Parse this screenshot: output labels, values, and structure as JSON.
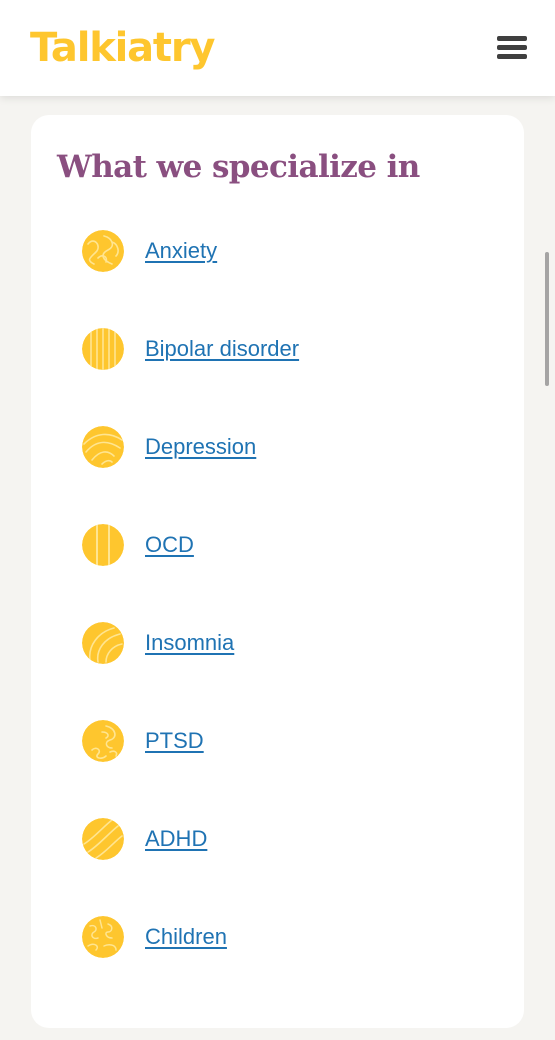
{
  "header": {
    "logo_text": "Talkiatry",
    "menu_icon": "hamburger-menu-icon"
  },
  "colors": {
    "brand_yellow": "#fec62e",
    "title_purple": "#8a4f80",
    "link_blue": "#1f73b3",
    "page_background": "#f5f4f1"
  },
  "specialties": {
    "title": "What we specialize in",
    "items": [
      {
        "label": "Anxiety",
        "icon": "anxiety-swirl-icon"
      },
      {
        "label": "Bipolar disorder",
        "icon": "bipolar-stripes-icon"
      },
      {
        "label": "Depression",
        "icon": "depression-waves-icon"
      },
      {
        "label": "OCD",
        "icon": "ocd-lines-icon"
      },
      {
        "label": "Insomnia",
        "icon": "insomnia-arcs-icon"
      },
      {
        "label": "PTSD",
        "icon": "ptsd-maze-icon"
      },
      {
        "label": "ADHD",
        "icon": "adhd-diagonal-icon"
      },
      {
        "label": "Children",
        "icon": "children-pattern-icon"
      }
    ]
  }
}
